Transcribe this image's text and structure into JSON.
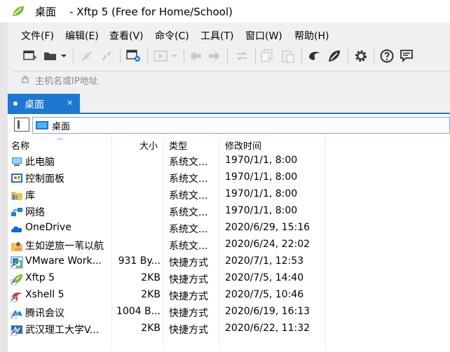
{
  "window": {
    "title": "桌面    - Xftp 5 (Free for Home/School)",
    "accent_color": "#1e78d3",
    "logo_icon": "xftp-leaf-icon"
  },
  "menu": {
    "items": [
      "文件(F)",
      "编辑(E)",
      "查看(V)",
      "命令(C)",
      "工具(T)",
      "窗口(W)",
      "帮助(H)"
    ]
  },
  "toolbar": {
    "icons": [
      "new-session-icon",
      "open-folder-icon",
      "dropdown-icon",
      "connect-icon",
      "disconnect-icon",
      "session-properties-icon",
      "transfer-icon",
      "dropdown-icon",
      "back-icon",
      "forward-icon",
      "refresh-icon",
      "copy-icon",
      "paste-icon",
      "xshell-icon",
      "xftp-icon",
      "settings-icon",
      "help-icon",
      "chat-icon"
    ]
  },
  "address": {
    "placeholder": "主机名或IP地址"
  },
  "tab": {
    "label": "桌面",
    "close": "×"
  },
  "path": {
    "value": "桌面"
  },
  "columns": {
    "name": "名称",
    "size": "大小",
    "type": "类型",
    "modified": "修改时间"
  },
  "files": [
    {
      "name": "此电脑",
      "size": "",
      "type": "系统文...",
      "modified": "1970/1/1, 8:00",
      "icon": "computer-icon"
    },
    {
      "name": "控制面板",
      "size": "",
      "type": "系统文...",
      "modified": "1970/1/1, 8:00",
      "icon": "control-panel-icon"
    },
    {
      "name": "库",
      "size": "",
      "type": "系统文...",
      "modified": "1970/1/1, 8:00",
      "icon": "library-icon"
    },
    {
      "name": "网络",
      "size": "",
      "type": "系统文...",
      "modified": "1970/1/1, 8:00",
      "icon": "network-icon"
    },
    {
      "name": "OneDrive",
      "size": "",
      "type": "系统文...",
      "modified": "2020/6/29, 15:16",
      "icon": "onedrive-icon"
    },
    {
      "name": "生如逆旅一苇以航",
      "size": "",
      "type": "系统文...",
      "modified": "2020/6/24, 22:02",
      "icon": "user-folder-icon"
    },
    {
      "name": "VMware Work...",
      "size": "931 By...",
      "type": "快捷方式",
      "modified": "2020/7/1, 12:53",
      "icon": "vmware-icon"
    },
    {
      "name": "Xftp 5",
      "size": "2KB",
      "type": "快捷方式",
      "modified": "2020/7/5, 14:40",
      "icon": "xftp-shortcut-icon"
    },
    {
      "name": "Xshell 5",
      "size": "2KB",
      "type": "快捷方式",
      "modified": "2020/7/5, 10:46",
      "icon": "xshell-shortcut-icon"
    },
    {
      "name": "腾讯会议",
      "size": "1004 B...",
      "type": "快捷方式",
      "modified": "2020/6/19, 16:13",
      "icon": "tencent-meeting-icon"
    },
    {
      "name": "武汉理工大学V...",
      "size": "2KB",
      "type": "快捷方式",
      "modified": "2020/6/22, 11:32",
      "icon": "vpn-shortcut-icon"
    }
  ]
}
